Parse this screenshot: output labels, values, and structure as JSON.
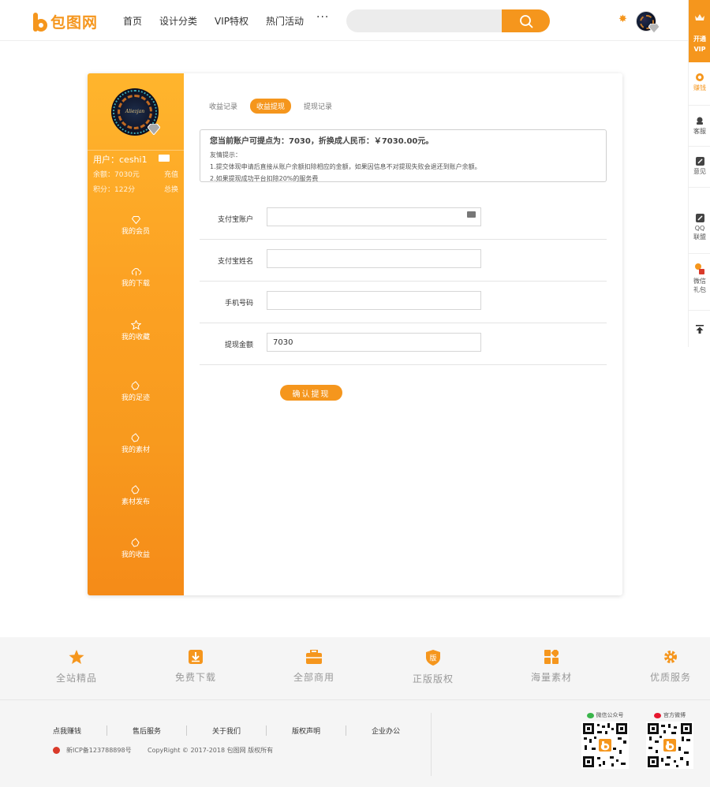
{
  "header": {
    "logo_text": "包图网",
    "nav": [
      "首页",
      "设计分类",
      "VIP特权",
      "热门活动"
    ],
    "more": "···",
    "search_placeholder": ""
  },
  "toolbar": {
    "vip_line1": "开通",
    "vip_line2": "VIP",
    "items": [
      "赚钱",
      "客服",
      "意见",
      "QQ",
      "联盟",
      "微信",
      "礼包"
    ]
  },
  "sidebar": {
    "avatar_signature": "Aliezjan",
    "user_label": "用户：ceshi1",
    "balance_label": "余额：7030元",
    "recharge_link": "充值",
    "points_label": "积分：122分",
    "total_link": "总换",
    "menu": [
      "我的会员",
      "我的下载",
      "我的收藏",
      "我的足迹",
      "我的素材",
      "素材发布",
      "我的收益"
    ]
  },
  "tabs": [
    "收益记录",
    "收益提现",
    "提现记录"
  ],
  "notice": {
    "title": "您当前账户可提点为：7030，折换成人民币：￥7030.00元。",
    "hint_label": "友情提示：",
    "line1": "1.提交体现申请后直接从账户余额扣除相应的金额，如果因信息不对提现失败会退还到账户余额。",
    "line2": "2.如果提现成功平台扣除20%的服务费"
  },
  "form": {
    "alipay_account_label": "支付宝账户",
    "alipay_account_value": "",
    "alipay_name_label": "支付宝姓名",
    "alipay_name_value": "",
    "phone_label": "手机号码",
    "phone_value": "",
    "amount_label": "提现金额",
    "amount_value": "7030",
    "submit_label": "确认提现"
  },
  "features": [
    "全站精品",
    "免费下载",
    "全部商用",
    "正版版权",
    "海量素材",
    "优质服务"
  ],
  "footer": {
    "links": [
      "点我赚钱",
      "售后服务",
      "关于我们",
      "版权声明",
      "企业办公"
    ],
    "icp": "新ICP备123788898号",
    "copyright": "CopyRight © 2017-2018 包图网 版权所有",
    "wechat_label": "微信公众号",
    "weibo_label": "官方微博"
  },
  "colors": {
    "accent": "#f5961d",
    "sidebar_top": "#ffb52d",
    "sidebar_bottom": "#f58b18"
  }
}
